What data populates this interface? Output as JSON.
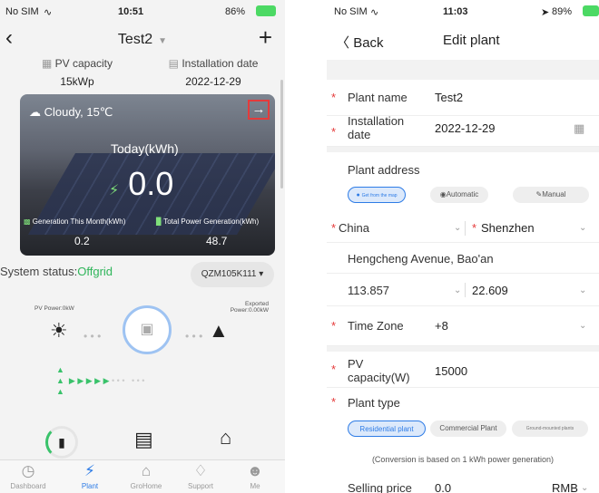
{
  "left": {
    "status": {
      "carrier": "No SIM",
      "time": "10:51",
      "battery": "86%"
    },
    "title": "Test2",
    "pv_capacity": {
      "label": "PV capacity",
      "value": "15kWp"
    },
    "installation": {
      "label": "Installation date",
      "value": "2022-12-29"
    },
    "weather": "Cloudy, 15℃",
    "today_label": "Today(kWh)",
    "today_value": "0.0",
    "gen_month": {
      "label": "Generation This Month(kWh)",
      "value": "0.2"
    },
    "total_gen": {
      "label": "Total Power Generation(kWh)",
      "value": "48.7"
    },
    "system_status_label": "System status:",
    "system_status_value": "Offgrid",
    "model": "QZM105K111",
    "pv_power": "PV Power:0kW",
    "exported": "Exported Power:0.00kW",
    "tabs": [
      "Dashboard",
      "Plant",
      "GroHome",
      "Support",
      "Me"
    ]
  },
  "right": {
    "status": {
      "carrier": "No SIM",
      "time": "11:03",
      "battery": "89%"
    },
    "back": "Back",
    "title": "Edit plant",
    "plant_name": {
      "label": "Plant name",
      "value": "Test2"
    },
    "install_date": {
      "label": "Installation date",
      "value": "2022-12-29"
    },
    "address_label": "Plant address",
    "addr_modes": [
      "Get from the map",
      "Automatic",
      "Manual"
    ],
    "country": "China",
    "city": "Shenzhen",
    "street": "Hengcheng Avenue, Bao'an",
    "lng": "113.857",
    "lat": "22.609",
    "timezone": {
      "label": "Time Zone",
      "value": "+8"
    },
    "pv_capacity": {
      "label": "PV capacity(W)",
      "value": "15000"
    },
    "plant_type_label": "Plant type",
    "plant_types": [
      "Residential plant",
      "Commercial Plant",
      "Ground-mounted plants"
    ],
    "note": "(Conversion is based on 1 kWh power generation)",
    "selling": {
      "label": "Selling price",
      "value": "0.0",
      "currency": "RMB"
    }
  }
}
